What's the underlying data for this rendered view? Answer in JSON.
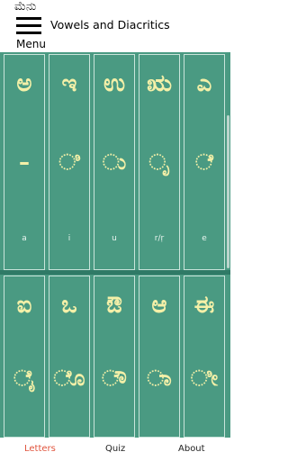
{
  "header": {
    "menu_kannada": "ಮೆನು",
    "menu_label": "Menu",
    "title": "Vowels and Diacritics"
  },
  "cards": [
    {
      "letter": "ಅ",
      "sign": "–",
      "translit": "a"
    },
    {
      "letter": "ಇ",
      "sign": "◌ಿ",
      "translit": "i"
    },
    {
      "letter": "ಉ",
      "sign": "◌ು",
      "translit": "u"
    },
    {
      "letter": "ಋ",
      "sign": "◌ೃ",
      "translit": "r/ṛ"
    },
    {
      "letter": "ಎ",
      "sign": "◌ೆ",
      "translit": "e"
    },
    {
      "letter": "ಐ",
      "sign": "◌ೈ",
      "translit": ""
    },
    {
      "letter": "ಒ",
      "sign": "◌ೊ",
      "translit": ""
    },
    {
      "letter": "ಔ",
      "sign": "◌ೌ",
      "translit": ""
    },
    {
      "letter": "ಆ",
      "sign": "◌ಾ",
      "translit": ""
    },
    {
      "letter": "ಈ",
      "sign": "◌ೀ",
      "translit": ""
    }
  ],
  "nav": {
    "letters": "Letters",
    "quiz": "Quiz",
    "about": "About"
  },
  "colors": {
    "grid_background": "#4a9a82",
    "glyph": "#f4f0a8",
    "active_tab": "#e0543d"
  },
  "icons": {
    "menu": "hamburger-icon"
  }
}
